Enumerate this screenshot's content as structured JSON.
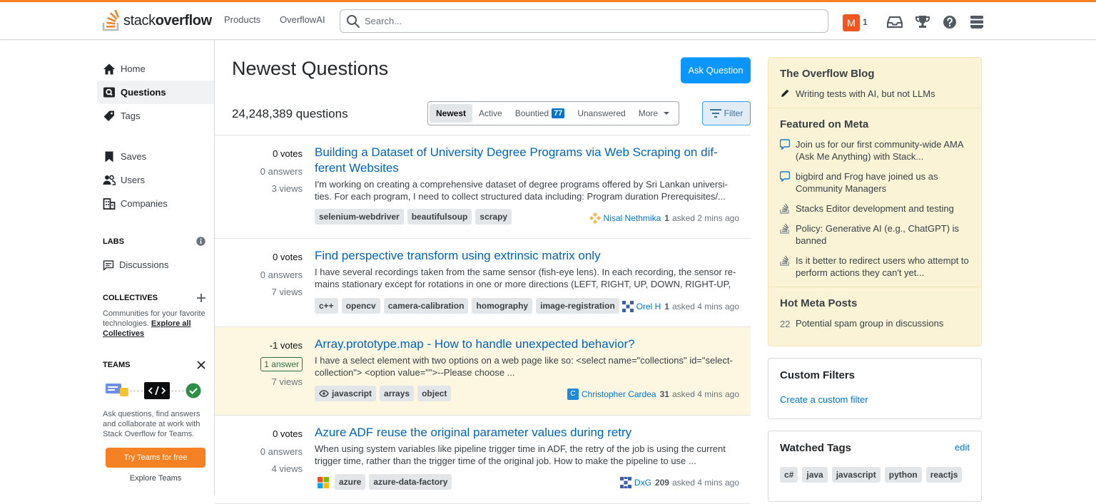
{
  "header": {
    "logo_text_light": "stack",
    "logo_text_bold": "overflow",
    "nav": [
      "Products",
      "OverflowAI"
    ],
    "search_placeholder": "Search...",
    "avatar_letter": "M",
    "reputation": "1"
  },
  "sidebar": {
    "items": [
      {
        "label": "Home",
        "icon": "home-icon"
      },
      {
        "label": "Questions",
        "icon": "questions-icon",
        "active": true
      },
      {
        "label": "Tags",
        "icon": "tag-icon"
      },
      {
        "label": "Saves",
        "icon": "bookmark-icon"
      },
      {
        "label": "Users",
        "icon": "users-icon"
      },
      {
        "label": "Companies",
        "icon": "building-icon"
      }
    ],
    "labs_heading": "LABS",
    "discussions_label": "Discussions",
    "collectives_heading": "COLLECTIVES",
    "collectives_text": "Communities for your favorite technologies.",
    "explore_collectives": "Explore all Collectives",
    "teams_heading": "TEAMS",
    "teams_text": "Ask questions, find answers and collaborate at work with Stack Overflow for Teams.",
    "try_teams": "Try Teams for free",
    "explore_teams": "Explore Teams"
  },
  "main": {
    "title": "Newest Questions",
    "ask_button": "Ask Question",
    "question_count": "24,248,389 questions",
    "tabs": [
      {
        "label": "Newest",
        "active": true
      },
      {
        "label": "Active"
      },
      {
        "label": "Bountied",
        "count": "77"
      },
      {
        "label": "Unanswered"
      },
      {
        "label": "More"
      }
    ],
    "filter_button": "Filter",
    "questions": [
      {
        "votes": "0 votes",
        "answers": "0 answers",
        "views": "3 views",
        "title": "Building a Dataset of University Degree Programs via Web Scraping on dif- ferent Websites",
        "excerpt": "I'm working on creating a comprehensive dataset of degree programs offered by Sri Lankan universi- ties. For each program, I need to collect structured data including: Program duration Prerequisites/...",
        "tags": [
          "selenium-webdriver",
          "beautifulsoup",
          "scrapy"
        ],
        "user": "Nisal Nethmika",
        "rep": "1",
        "time": "asked 2 mins ago",
        "avatar_color": "#f5b43a"
      },
      {
        "votes": "0 votes",
        "answers": "0 answers",
        "views": "7 views",
        "title": "Find perspective transform using extrinsic matrix only",
        "excerpt": "I have several recordings taken from the same sensor (fish-eye lens). In each recording, the sensor re- mains stationary except for rotations in one or more directions (LEFT, RIGHT, UP, DOWN, RIGHT-UP, ...",
        "tags": [
          "c++",
          "opencv",
          "camera-calibration",
          "homography",
          "image-registration"
        ],
        "user": "Orel H",
        "rep": "1",
        "time": "asked 4 mins ago",
        "avatar_color": "#3d5ea8"
      },
      {
        "votes": "-1 votes",
        "answers": "1 answer",
        "views": "7 views",
        "title": "Array.prototype.map - How to handle unexpected behavior?",
        "excerpt": "I have a select element with two options on a web page like so: <select name=\"collections\" id=\"select- collection\"> <option value=\"\">--Please choose ...",
        "tags": [
          "javascript",
          "arrays",
          "object"
        ],
        "user": "Christopher Cardea",
        "rep": "31",
        "time": "asked 4 mins ago",
        "avatar_color": "#1f8ad6",
        "avatar_letter": "C"
      },
      {
        "votes": "0 votes",
        "answers": "0 answers",
        "views": "4 views",
        "title": "Azure ADF reuse the original parameter values during retry",
        "excerpt": "When using system variables like pipeline trigger time in ADF, the retry of the job is using the current trigger time, rather than the trigger time of the original job. How to make the pipeline to use ...",
        "tags": [
          "azure",
          "azure-data-factory"
        ],
        "user": "DxG",
        "rep": "209",
        "time": "asked 4 mins ago",
        "avatar_color": "#3d5ea8"
      }
    ]
  },
  "rightbar": {
    "blog_heading": "The Overflow Blog",
    "blog_items": [
      "Writing tests with AI, but not LLMs"
    ],
    "meta_heading": "Featured on Meta",
    "meta_items": [
      {
        "text": "Join us for our first community-wide AMA (Ask Me Anything) with Stack...",
        "icon": "chat-bubble-icon"
      },
      {
        "text": "bigbird and Frog have joined us as Community Managers",
        "icon": "chat-bubble-icon"
      },
      {
        "text": "Stacks Editor development and testing",
        "icon": "stack-icon"
      },
      {
        "text": "Policy: Generative AI (e.g., ChatGPT) is banned",
        "icon": "stack-icon"
      },
      {
        "text": "Is it better to redirect users who attempt to perform actions they can't yet...",
        "icon": "stack-icon"
      }
    ],
    "hot_heading": "Hot Meta Posts",
    "hot_items": [
      {
        "count": "22",
        "text": "Potential spam group in discussions"
      }
    ],
    "custom_filters_heading": "Custom Filters",
    "custom_filter_link": "Create a custom filter",
    "watched_heading": "Watched Tags",
    "watched_edit": "edit",
    "watched_tags": [
      "c#",
      "java",
      "javascript",
      "python",
      "reactjs"
    ]
  },
  "colors": {
    "accent": "#f48225",
    "link": "#0074cc",
    "button": "#0a95ff",
    "highlight": "#fdf7e2"
  }
}
